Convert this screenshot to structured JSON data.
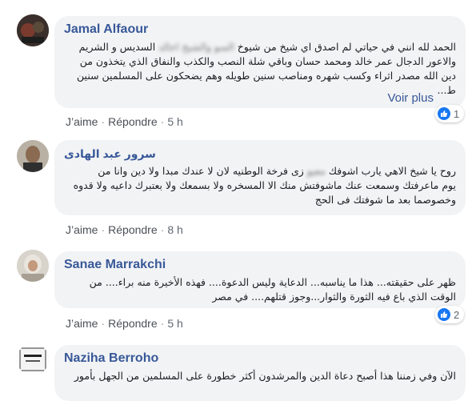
{
  "comments": [
    {
      "author": "Jamal Alfaour",
      "text_lines": [
        "الحمد لله انني في حياتي لم اصدق اي شيخ من شيوخ",
        "والاعور الدجال عمر خالد ومحمد حسان وباقي شلة النصب والكذب والنفاق الذي يتخذون من",
        "دين الله مصدر اثراء وكسب شهره ومناصب سنين طويله وهم يضحكون على المسلمين سنين",
        "ط..."
      ],
      "blurred_words": "السو والشيخ اخالد",
      "line1_tail": "السديس و الشريم",
      "see_more": "Voir plus",
      "actions": {
        "like": "J’aime",
        "reply": "Répondre",
        "time": "5 h"
      },
      "reactions": "1"
    },
    {
      "author": "سرور عبد الهادى",
      "text_lines": [
        "روح يا شيخ الاهي يارب اشوفك",
        "يوم ماعرفتك وسمعت عنك ماشوفتش منك الا المسخره ولا بسمعك ولا بعتبرك داعيه ولا قدوه",
        "وخصوصما بعد ما شوفتك فى الحج"
      ],
      "blurred_words": "معيو",
      "line1_tail": "زى فرخة الوطنيه لان لا عندك مبدا ولا دين وانا من",
      "actions": {
        "like": "J’aime",
        "reply": "Répondre",
        "time": "8 h"
      }
    },
    {
      "author": "Sanae Marrakchi",
      "text_lines": [
        "ظهر على حقيقته... هذا ما يناسبه... الدعاية وليس الدعوة.... فهذه الأخيرة منه براء.... من",
        "الوقت الذي باع فيه الثورة والثوار...وجوز قتلهم.... في مصر"
      ],
      "actions": {
        "like": "J’aime",
        "reply": "Répondre",
        "time": "5 h"
      },
      "reactions": "2"
    },
    {
      "author": "Naziha Berroho",
      "text_lines": [
        "الآن وفي زمننا هذا أصبح دعاة الدين والمرشدون أكثر خطورة على المسلمين من الجهل بأمور"
      ]
    }
  ],
  "colors": {
    "link": "#385898",
    "bubble": "#f2f3f5",
    "like_blue": "#1877f2"
  }
}
